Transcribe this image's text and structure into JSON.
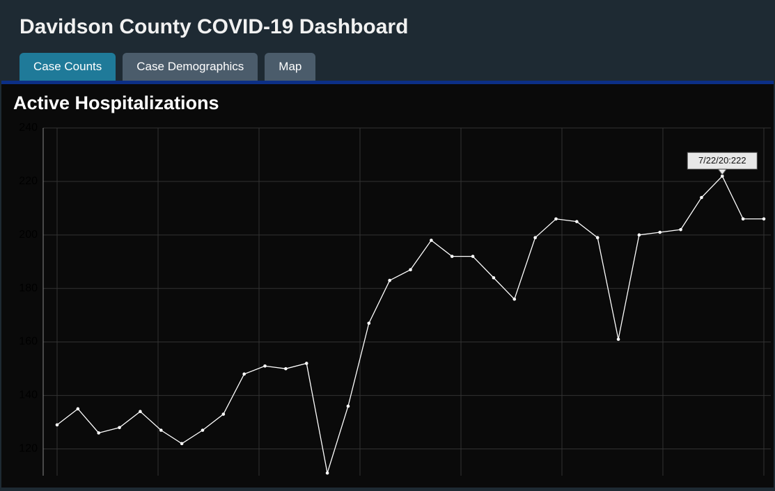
{
  "header": {
    "title": "Davidson County COVID-19 Dashboard",
    "tabs": [
      {
        "label": "Case Counts",
        "active": true
      },
      {
        "label": "Case Demographics",
        "active": false
      },
      {
        "label": "Map",
        "active": false
      }
    ]
  },
  "chart_data": {
    "type": "line",
    "title": "Active Hospitalizations",
    "xlabel": "",
    "ylabel": "",
    "ylim": [
      110,
      240
    ],
    "y_ticks": [
      120,
      140,
      160,
      180,
      200,
      220,
      240
    ],
    "x": [
      0,
      1,
      2,
      3,
      4,
      5,
      6,
      7,
      8,
      9,
      10,
      11,
      12,
      13,
      14,
      15,
      16,
      17,
      18,
      19,
      20,
      21,
      22,
      23,
      24,
      25,
      26,
      27,
      28,
      29,
      30,
      31,
      32,
      33,
      34
    ],
    "series": [
      {
        "name": "Active Hospitalizations",
        "values": [
          129,
          135,
          126,
          128,
          134,
          127,
          122,
          127,
          133,
          148,
          151,
          150,
          152,
          111,
          136,
          167,
          183,
          187,
          198,
          192,
          192,
          184,
          176,
          199,
          206,
          205,
          199,
          161,
          200,
          201,
          202,
          214,
          222,
          206,
          206
        ]
      }
    ],
    "tooltip": {
      "index": 32,
      "text": "7/22/20:222"
    },
    "colors": {
      "line": "#ffffff",
      "grid": "#333333",
      "tooltip_bg": "#e8e8e8",
      "tooltip_text": "#111111"
    }
  }
}
